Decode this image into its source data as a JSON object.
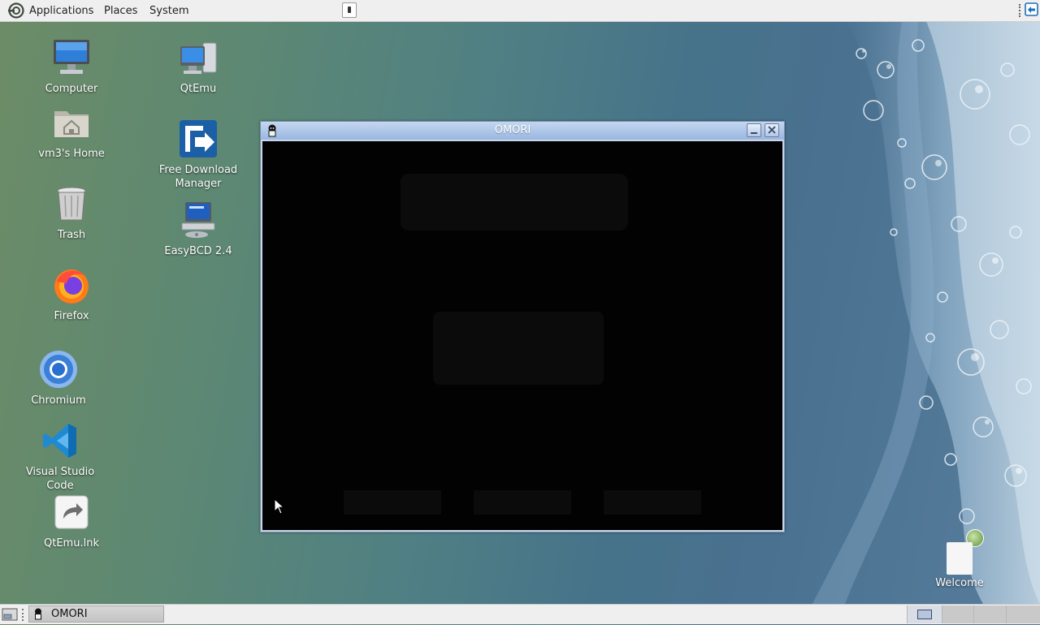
{
  "top_panel": {
    "menu": [
      "Applications",
      "Places",
      "System"
    ]
  },
  "desktop": {
    "icons_col1": [
      "Computer",
      "vm3's Home",
      "Trash",
      "Firefox",
      "Chromium",
      "Visual Studio Code",
      "QtEmu.lnk"
    ],
    "icons_col2": [
      {
        "label": "QtEmu"
      },
      {
        "label": "Free Download Manager"
      },
      {
        "label": "EasyBCD 2.4"
      }
    ],
    "welcome": "Welcome"
  },
  "window": {
    "title": "OMORI"
  },
  "taskbar": {
    "task_label": "OMORI"
  },
  "colors": {
    "panel_bg": "#efefef",
    "titlebar_top": "#c4d7f1",
    "titlebar_bottom": "#9ab7e0",
    "window_content": "#020202"
  }
}
